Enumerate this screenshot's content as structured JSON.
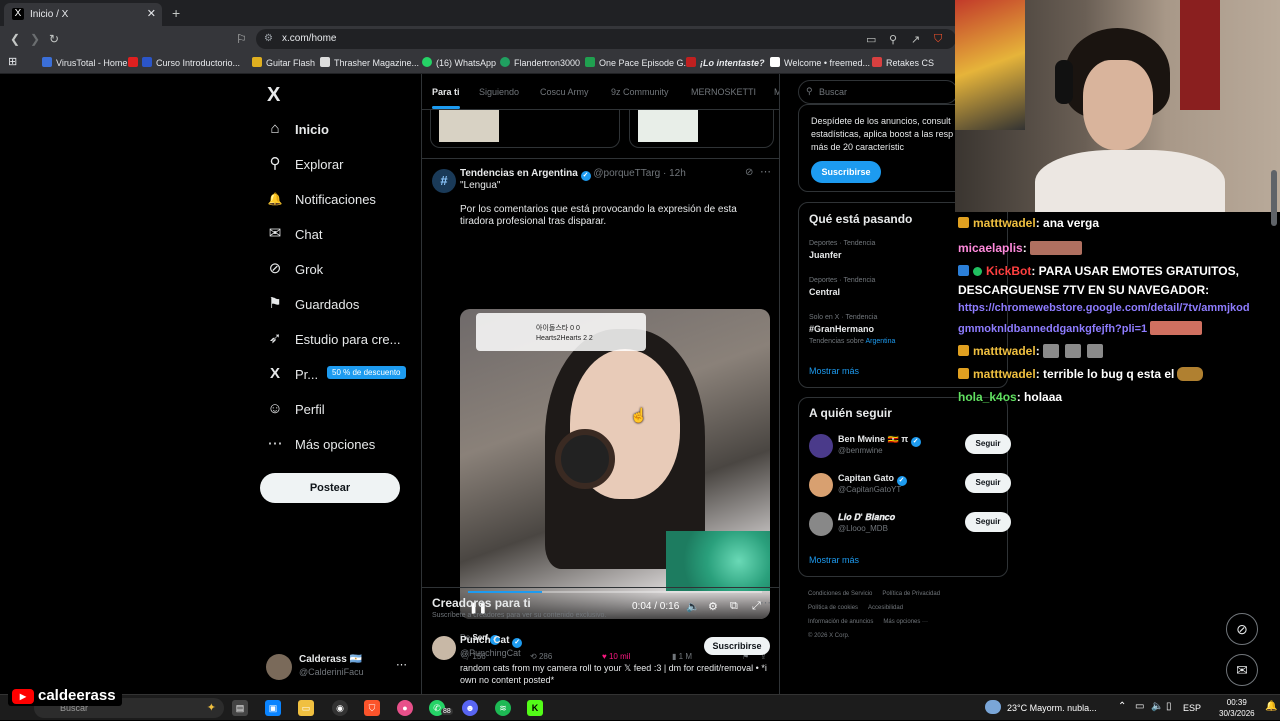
{
  "browser": {
    "tab_title": "Inicio / X",
    "tab_close": "✕",
    "new_tab": "+",
    "url": "x.com/home",
    "bookmarks": [
      {
        "label": "VirusTotal - Home",
        "color": "#3b6fd8"
      },
      {
        "label": "Curso Introductorio...",
        "color": "#2b55c8"
      },
      {
        "label": "Guitar Flash",
        "color": "#e0b020"
      },
      {
        "label": "Thrasher Magazine...",
        "color": "#dddddd"
      },
      {
        "label": "(16) WhatsApp",
        "color": "#25d366"
      },
      {
        "label": "Flandertron3000",
        "color": "#20a060"
      },
      {
        "label": "One Pace Episode G...",
        "color": "#20a050"
      },
      {
        "label": "¡Lo intentaste?",
        "color": "#c02020"
      },
      {
        "label": "Welcome • freemed...",
        "color": "#ffffff"
      },
      {
        "label": "Retakes CS",
        "color": "#d84040"
      }
    ]
  },
  "nav": {
    "logo": "X",
    "items": [
      {
        "label": "Inicio",
        "icon": "home-icon",
        "glyph": "⌂"
      },
      {
        "label": "Explorar",
        "icon": "search-icon",
        "glyph": "⚲"
      },
      {
        "label": "Notificaciones",
        "icon": "bell-icon",
        "glyph": "🔔"
      },
      {
        "label": "Chat",
        "icon": "mail-icon",
        "glyph": "✉"
      },
      {
        "label": "Grok",
        "icon": "grok-icon",
        "glyph": "⊘"
      },
      {
        "label": "Guardados",
        "icon": "bookmark-icon",
        "glyph": "⚑"
      },
      {
        "label": "Estudio para cre...",
        "icon": "rocket-icon",
        "glyph": "➶"
      },
      {
        "label": "Pr...",
        "icon": "x-premium-icon",
        "glyph": "X"
      },
      {
        "label": "Perfil",
        "icon": "person-icon",
        "glyph": "☺"
      },
      {
        "label": "Más opciones",
        "icon": "more-circle-icon",
        "glyph": "⋯"
      }
    ],
    "premium_badge": "50 % de descuento",
    "post_button": "Postear",
    "profile": {
      "name": "Calderass 🇦🇷",
      "handle": "@CalderiniFacu",
      "more": "⋯"
    }
  },
  "feed": {
    "tabs": [
      "Para ti",
      "Siguiendo",
      "Coscu Army",
      "9z Community",
      "MERNOSKETTI",
      "M"
    ],
    "active_tab": "Para ti",
    "post": {
      "author": "Tendencias en Argentina",
      "handle_time": "@porqueTTarg · 12h",
      "topic": "\"Lengua\"",
      "text": "Por los comentarios que está provocando la expresión de esta tiradora profesional tras disparar.",
      "video": {
        "time": "0:04 / 0:16",
        "progress": 0.25,
        "score_rows": [
          "아이돌스타   0   0",
          "Hearts2Hearts   2   2"
        ]
      },
      "from_label": "De",
      "from_name": "Serf",
      "replies": "156",
      "reposts": "286",
      "likes": "10 mil",
      "views": "1 M"
    },
    "creators": {
      "title": "Creadores para ti",
      "subtitle": "Suscríbete a creadores para ver su contenido exclusivo.",
      "more": "⋯",
      "creator": {
        "name": "Punch Cat",
        "handle": "@PunchingCat",
        "subscribe": "Suscribirse",
        "bio": "random cats from my camera roll to your 𝕏 feed :3 | dm for credit/removal • *i own no content posted*"
      }
    }
  },
  "sidebar": {
    "search_placeholder": "Buscar",
    "premium_text": "Despídete de los anuncios, consult estadísticas, aplica boost a las resp aprovecha más de 20 característic",
    "premium_button": "Suscribirse",
    "trending_title": "Qué está pasando",
    "trends": [
      {
        "context": "Deportes · Tendencia",
        "name": "Juanfer",
        "sub_prefix": "",
        "sub_link": ""
      },
      {
        "context": "Deportes · Tendencia",
        "name": "Central",
        "sub_prefix": "",
        "sub_link": ""
      },
      {
        "context": "Solo en X · Tendencia",
        "name": "#GranHermano",
        "sub_prefix": "Tendencias sobre ",
        "sub_link": "Argentina"
      }
    ],
    "show_more": "Mostrar más",
    "follow_title": "A quién seguir",
    "follow": [
      {
        "name": "Ben Mwine 🇺🇬 π",
        "handle": "@benmwine",
        "color": "#4a3a8a"
      },
      {
        "name": "Capitan Gato",
        "handle": "@CapitanGatoYT",
        "color": "#d8a070"
      },
      {
        "name": "𝑳𝒊𝒐 𝑫' 𝑩𝒍𝒂𝒏𝒄𝒐",
        "handle": "@Llooo_MDB",
        "color": "#888888"
      }
    ],
    "follow_button": "Seguir",
    "footer": [
      "Condiciones de Servicio",
      "Política de Privacidad",
      "Política de cookies",
      "Accesibilidad",
      "Información de anuncios",
      "Más opciones ···",
      "© 2026 X Corp."
    ]
  },
  "chat": {
    "lines": [
      {
        "user": "matttwadel",
        "msg": ": ana verga",
        "user_color": "#f0c040"
      },
      {
        "user": "micaelaplis",
        "msg": ":",
        "user_color": "#ff8adc"
      },
      {
        "user": "KickBot",
        "msg": ": PARA USAR EMOTES GRATUITOS,",
        "user_color": "#ff4040"
      },
      {
        "user": "",
        "msg": "DESCARGUENSE 7TV EN SU NAVEGADOR:",
        "user_color": "#ffffff"
      },
      {
        "user": "",
        "msg": "https://chromewebstore.google.com/detail/7tv/ammjkod",
        "user_color": "#ffffff"
      },
      {
        "user": "",
        "msg": "gmmoknldbanneddgankgfejfh?pli=1",
        "user_color": "#ffffff"
      },
      {
        "user": "matttwadel",
        "msg": ":",
        "user_color": "#f0c040"
      },
      {
        "user": "matttwadel",
        "msg": ": terrible lo bug q esta el",
        "user_color": "#f0c040"
      },
      {
        "user": "hola_k4os",
        "msg": ": holaaa",
        "user_color": "#60e060"
      }
    ]
  },
  "stream": {
    "channel": "caldeerass"
  },
  "taskbar": {
    "search": "Buscar",
    "whatsapp_count": "88",
    "weather": "23°C  Mayorm. nubla...",
    "lang": "ESP",
    "time": "00:39",
    "date": "30/3/2026"
  }
}
